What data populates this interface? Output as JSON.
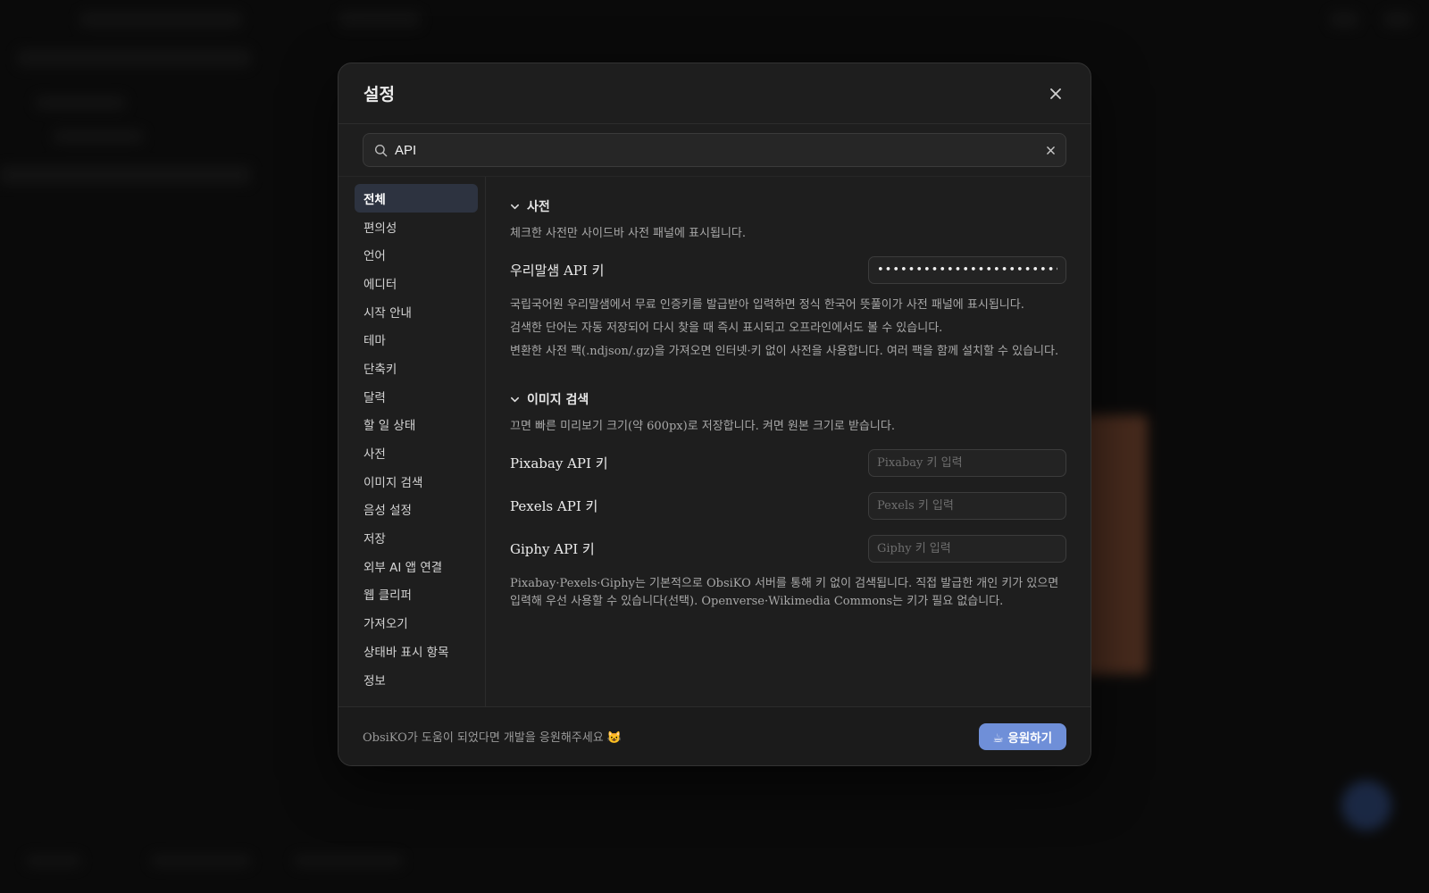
{
  "modal": {
    "title": "설정",
    "close_icon": "close-icon"
  },
  "search": {
    "value": "API",
    "placeholder": "",
    "icon": "search-icon",
    "clear_icon": "close-icon"
  },
  "sidebar": {
    "items": [
      {
        "label": "전체",
        "active": true
      },
      {
        "label": "편의성"
      },
      {
        "label": "언어"
      },
      {
        "label": "에디터"
      },
      {
        "label": "시작 안내"
      },
      {
        "label": "테마"
      },
      {
        "label": "단축키"
      },
      {
        "label": "달력"
      },
      {
        "label": "할 일 상태"
      },
      {
        "label": "사전"
      },
      {
        "label": "이미지 검색"
      },
      {
        "label": "음성 설정"
      },
      {
        "label": "저장"
      },
      {
        "label": "외부 AI 앱 연결"
      },
      {
        "label": "웹 클리퍼"
      },
      {
        "label": "가져오기"
      },
      {
        "label": "상태바 표시 항목"
      },
      {
        "label": "정보"
      }
    ]
  },
  "dictionary": {
    "title": "사전",
    "desc": "체크한 사전만 사이드바 사전 패널에 표시됩니다.",
    "api_label": "우리말샘 API 키",
    "api_value": "••••••••••••••••••••••••",
    "desc2": "국립국어원 우리말샘에서 무료 인증키를 발급받아 입력하면 정식 한국어 뜻풀이가 사전 패널에 표시됩니다.",
    "desc3": "검색한 단어는 자동 저장되어 다시 찾을 때 즉시 표시되고 오프라인에서도 볼 수 있습니다.",
    "desc4": "변환한 사전 팩(.ndjson/.gz)을 가져오면 인터넷·키 없이 사전을 사용합니다. 여러 팩을 함께 설치할 수 있습니다."
  },
  "image_search": {
    "title": "이미지 검색",
    "desc": "끄면 빠른 미리보기 크기(약 600px)로 저장합니다. 켜면 원본 크기로 받습니다.",
    "pixabay_label": "Pixabay API 키",
    "pixabay_placeholder": "Pixabay 키 입력",
    "pexels_label": "Pexels API 키",
    "pexels_placeholder": "Pexels 키 입력",
    "giphy_label": "Giphy API 키",
    "giphy_placeholder": "Giphy 키 입력",
    "note": "Pixabay·Pexels·Giphy는 기본적으로 ObsiKO 서버를 통해 키 없이 검색됩니다. 직접 발급한 개인 키가 있으면 입력해 우선 사용할 수 있습니다(선택). Openverse·Wikimedia Commons는 키가 필요 없습니다."
  },
  "footer": {
    "text": "ObsiKO가 도움이 되었다면 개발을 응원해주세요 😺",
    "button_label": "☕ 응원하기"
  },
  "colors": {
    "accent": "#6f8fd8",
    "active_nav": "#2d3340",
    "background": "#101010",
    "modal": "#1e1e1e"
  }
}
